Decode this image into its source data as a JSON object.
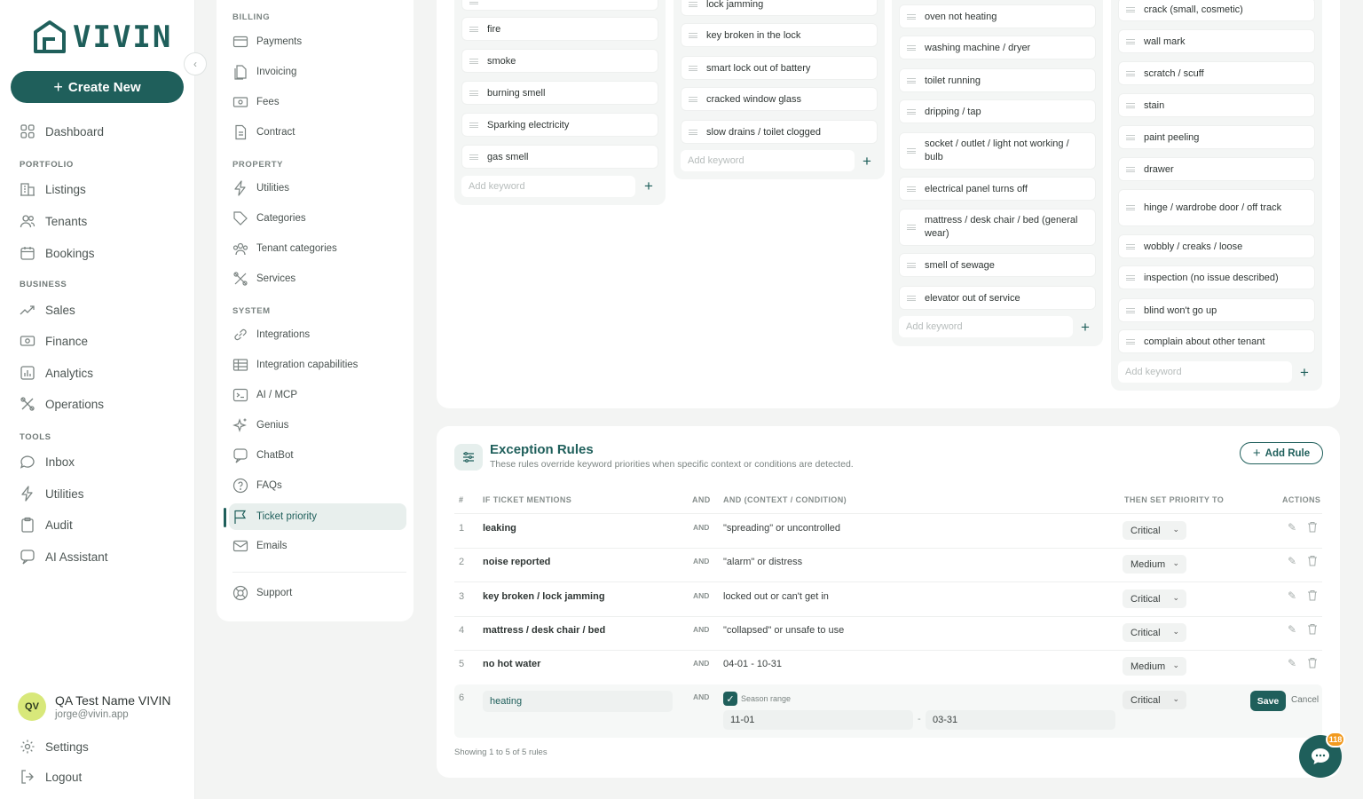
{
  "brand": {
    "name": "VIVIN",
    "accent": "#1f5f5b"
  },
  "sidebar": {
    "create_label": "Create New",
    "dashboard": "Dashboard",
    "sections": {
      "portfolio": "PORTFOLIO",
      "business": "BUSINESS",
      "tools": "TOOLS"
    },
    "portfolio": [
      "Listings",
      "Tenants",
      "Bookings"
    ],
    "business": [
      "Sales",
      "Finance",
      "Analytics",
      "Operations"
    ],
    "tools": [
      "Inbox",
      "Utilities",
      "Audit",
      "AI Assistant"
    ],
    "user": {
      "initials": "QV",
      "name": "QA Test Name VIVIN",
      "email": "jorge@vivin.app"
    },
    "settings": "Settings",
    "logout": "Logout"
  },
  "settings_menu": {
    "sections": {
      "billing": "BILLING",
      "property": "PROPERTY",
      "system": "SYSTEM"
    },
    "billing": [
      "Payments",
      "Invoicing",
      "Fees",
      "Contract"
    ],
    "property": [
      "Utilities",
      "Categories",
      "Tenant categories",
      "Services"
    ],
    "system": [
      "Integrations",
      "Integration capabilities",
      "AI / MCP",
      "Genius",
      "ChatBot",
      "FAQs",
      "Ticket priority",
      "Emails"
    ],
    "support": "Support"
  },
  "keywords": {
    "add_placeholder": "Add keyword",
    "col1": [
      "fire",
      "smoke",
      "burning smell",
      "Sparking electricity",
      "gas smell"
    ],
    "col2": [
      "lock jamming",
      "key broken in the lock",
      "smart lock out of battery",
      "cracked window glass",
      "slow drains / toilet clogged"
    ],
    "col3": [
      "oven not heating",
      "washing machine / dryer",
      "toilet running",
      "dripping / tap",
      "socket / outlet / light not working / bulb",
      "electrical panel turns off",
      "mattress / desk chair / bed (general wear)",
      "smell of sewage",
      "elevator out of service"
    ],
    "col4": [
      "crack (small, cosmetic)",
      "wall mark",
      "scratch / scuff",
      "stain",
      "paint peeling",
      "drawer",
      "hinge / wardrobe door / off track",
      "wobbly / creaks / loose",
      "inspection (no issue described)",
      "blind won't go up",
      "complain about other tenant"
    ]
  },
  "rules": {
    "title": "Exception Rules",
    "subtitle": "These rules override keyword priorities when specific context or conditions are detected.",
    "add_label": "Add Rule",
    "headers": {
      "num": "#",
      "mentions": "IF TICKET MENTIONS",
      "and": "AND",
      "context": "AND (CONTEXT / CONDITION)",
      "priority": "THEN SET PRIORITY TO",
      "actions": "ACTIONS"
    },
    "and_label": "AND",
    "rows": [
      {
        "n": "1",
        "mention": "leaking",
        "context": "\"spreading\" or uncontrolled",
        "priority": "Critical"
      },
      {
        "n": "2",
        "mention": "noise reported",
        "context": "\"alarm\" or distress",
        "priority": "Medium"
      },
      {
        "n": "3",
        "mention": "key broken / lock jamming",
        "context": "locked out or can't get in",
        "priority": "Critical"
      },
      {
        "n": "4",
        "mention": "mattress / desk chair / bed",
        "context": "\"collapsed\" or unsafe to use",
        "priority": "Critical"
      },
      {
        "n": "5",
        "mention": "no hot water",
        "context": "04-01 - 10-31",
        "priority": "Medium"
      }
    ],
    "edit": {
      "n": "6",
      "mention": "heating",
      "season_label": "Season range",
      "from": "11-01",
      "sep": "-",
      "to": "03-31",
      "priority": "Critical",
      "save": "Save",
      "cancel": "Cancel"
    },
    "footer": "Showing 1 to 5 of 5 rules"
  },
  "chat": {
    "badge": "118"
  }
}
